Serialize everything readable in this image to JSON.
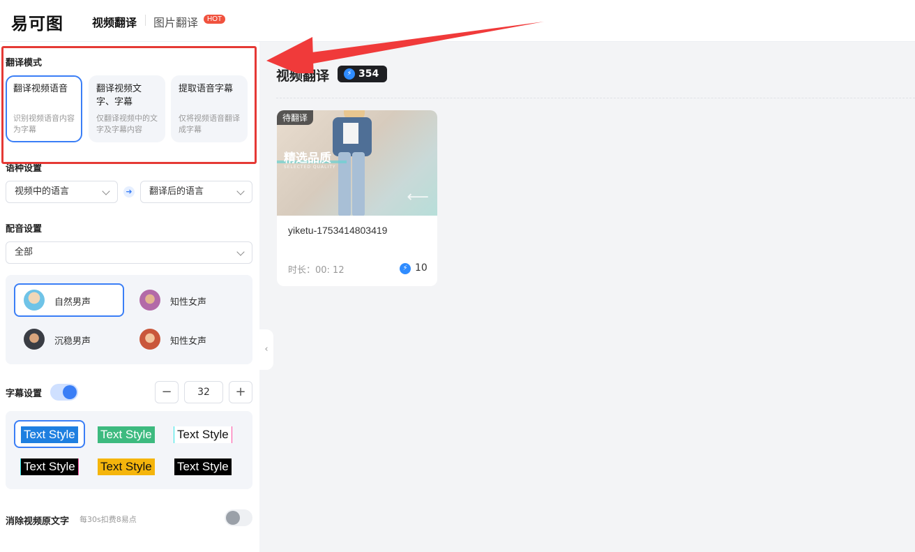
{
  "header": {
    "logo": "易可图",
    "tabs": [
      {
        "label": "视频翻译",
        "active": true
      },
      {
        "label": "图片翻译",
        "badge": "HOT"
      }
    ]
  },
  "sidebar": {
    "mode": {
      "title": "翻译模式",
      "cards": [
        {
          "title": "翻译视频语音",
          "desc": "识别视频语音内容为字幕",
          "selected": true
        },
        {
          "title": "翻译视频文字、字幕",
          "desc": "仅翻译视频中的文字及字幕内容"
        },
        {
          "title": "提取语音字幕",
          "desc": "仅将视频语音翻译成字幕"
        }
      ]
    },
    "language": {
      "title": "语种设置",
      "source_placeholder": "视频中的语言",
      "target_placeholder": "翻译后的语言"
    },
    "dubbing": {
      "title": "配音设置",
      "filter_value": "全部",
      "voices": [
        {
          "label": "自然男声",
          "selected": true
        },
        {
          "label": "知性女声"
        },
        {
          "label": "沉稳男声"
        },
        {
          "label": "知性女声"
        }
      ]
    },
    "subtitle": {
      "title": "字幕设置",
      "enabled": true,
      "minus": "−",
      "plus": "+",
      "font_size": "32",
      "styles": [
        {
          "label": "Text Style",
          "fg": "#ffffff",
          "bg": "#1e7fe0",
          "selected": true
        },
        {
          "label": "Text Style",
          "fg": "#ffffff",
          "bg": "#3dba7f"
        },
        {
          "label": "Text Style",
          "fg": "#111111",
          "bg": "#ffffff"
        },
        {
          "label": "Text Style",
          "fg": "#ffffff",
          "bg": "#000000"
        },
        {
          "label": "Text Style",
          "fg": "#111111",
          "bg": "#f5b50c"
        },
        {
          "label": "Text Style",
          "fg": "#ffffff",
          "bg": "#000000"
        }
      ]
    },
    "remove_text": {
      "title": "消除视频原文字",
      "hint": "每30s扣费8易点",
      "enabled": false
    }
  },
  "main": {
    "title": "视频翻译",
    "credits": "354",
    "videos": [
      {
        "status": "待翻译",
        "thumb_title": "精选品质",
        "thumb_subtitle": "SELECTED QUALITY",
        "name": "yiketu-1753414803419",
        "duration": "时长：00: 12",
        "cost": "10"
      }
    ]
  },
  "colors": {
    "accent": "#3a7ef6",
    "annotation": "#e53935",
    "hot": "#f0523e"
  }
}
